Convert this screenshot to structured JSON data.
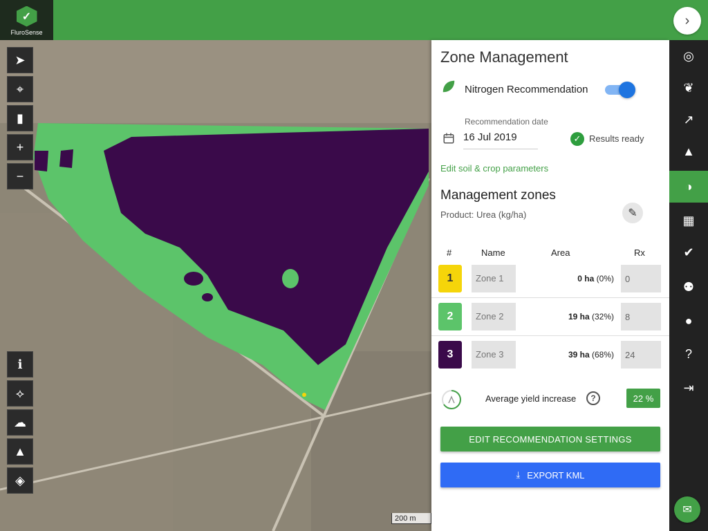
{
  "app": {
    "logo_text": "FluroSense"
  },
  "panel": {
    "title": "Zone Management",
    "nitrogen_label": "Nitrogen Recommendation",
    "nitrogen_enabled": true,
    "date_label": "Recommendation date",
    "date_value": "16 Jul 2019",
    "status_text": "Results ready",
    "edit_soil_link": "Edit soil & crop parameters",
    "zones_title": "Management zones",
    "product_text": "Product: Urea (kg/ha)",
    "columns": {
      "num": "#",
      "name": "Name",
      "area": "Area",
      "rx": "Rx"
    },
    "zones": [
      {
        "num": "1",
        "name": "Zone 1",
        "area_ha": "0 ha",
        "area_pct": "(0%)",
        "rx": "0",
        "color": "#f5d50a",
        "text_color": "#333333"
      },
      {
        "num": "2",
        "name": "Zone 2",
        "area_ha": "19 ha",
        "area_pct": "(32%)",
        "rx": "8",
        "color": "#5cc46a",
        "text_color": "#ffffff"
      },
      {
        "num": "3",
        "name": "Zone 3",
        "area_ha": "39 ha",
        "area_pct": "(68%)",
        "rx": "24",
        "color": "#3a0a4a",
        "text_color": "#ffffff"
      }
    ],
    "yield_label": "Average yield increase",
    "yield_value": "22 %",
    "edit_button": "EDIT RECOMMENDATION SETTINGS",
    "export_button": "EXPORT KML"
  },
  "map": {
    "scale_label": "200 m",
    "tools_top": [
      "navigate-icon",
      "locate-icon",
      "ruler-icon",
      "zoom-in-icon",
      "zoom-out-icon"
    ],
    "tools_bottom": [
      "info-icon",
      "draw-polygon-icon",
      "weather-icon",
      "alert-icon",
      "layers-icon"
    ]
  },
  "rail": {
    "items": [
      "fields-icon",
      "crop-icon",
      "analytics-icon",
      "alerts-icon",
      "zones-icon",
      "imagery-icon",
      "tasks-icon",
      "users-icon",
      "account-icon",
      "help-icon",
      "logout-icon"
    ],
    "active_index": 4
  },
  "colors": {
    "brand_green": "#43a047",
    "export_blue": "#2f6bf5"
  }
}
